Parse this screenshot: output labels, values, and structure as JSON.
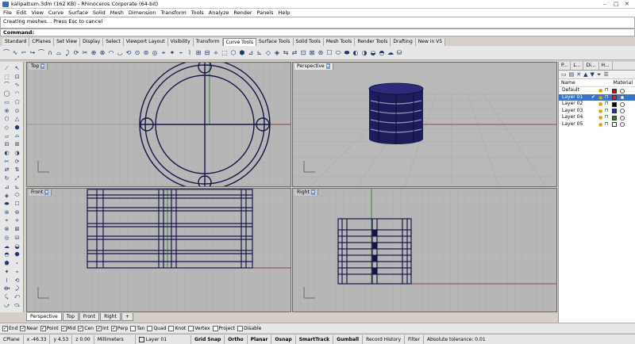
{
  "window": {
    "title": "kalipattum.3dm (162 KB) - Rhinoceros Corporate (64-bit)"
  },
  "menu": [
    "File",
    "Edit",
    "View",
    "Curve",
    "Surface",
    "Solid",
    "Mesh",
    "Dimension",
    "Transform",
    "Tools",
    "Analyze",
    "Render",
    "Panels",
    "Help"
  ],
  "command": {
    "history1": "Creating meshes... Press Esc to cancel",
    "history2": "",
    "prompt": "Command:"
  },
  "tabs": [
    "Standard",
    "CPlanes",
    "Set View",
    "Display",
    "Select",
    "Viewport Layout",
    "Visibility",
    "Transform",
    "Curve Tools",
    "Surface Tools",
    "Solid Tools",
    "Mesh Tools",
    "Render Tools",
    "Drafting",
    "New in V5"
  ],
  "active_tab": "Curve Tools",
  "viewports": {
    "top": "Top",
    "perspective": "Perspective",
    "front": "Front",
    "right": "Right",
    "menu_arrow": "▾"
  },
  "viewport_tabs": [
    "Perspective",
    "Top",
    "Front",
    "Right",
    "+"
  ],
  "osnaps": [
    {
      "label": "End",
      "checked": true
    },
    {
      "label": "Near",
      "checked": true
    },
    {
      "label": "Point",
      "checked": true
    },
    {
      "label": "Mid",
      "checked": true
    },
    {
      "label": "Cen",
      "checked": true
    },
    {
      "label": "Int",
      "checked": true
    },
    {
      "label": "Perp",
      "checked": true
    },
    {
      "label": "Tan",
      "checked": false
    },
    {
      "label": "Quad",
      "checked": false
    },
    {
      "label": "Knot",
      "checked": false
    },
    {
      "label": "Vertex",
      "checked": false
    },
    {
      "label": "Project",
      "checked": false
    },
    {
      "label": "Disable",
      "checked": false
    }
  ],
  "status": {
    "cplane": "CPlane",
    "x": "x -46.33",
    "y": "y 4.53",
    "z": "z 0.00",
    "units": "Millimeters",
    "layer": "Layer 01",
    "layer_color": "#b3151c",
    "grid_snap": "Grid Snap",
    "ortho": "Ortho",
    "planar": "Planar",
    "osnap": "Osnap",
    "smarttrack": "SmartTrack",
    "gumball": "Gumball",
    "record_history": "Record History",
    "filter": "Filter",
    "tolerance": "Absolute tolerance: 0.01"
  },
  "panel": {
    "tabs": [
      "P...",
      "L...",
      "Di...",
      "H..."
    ],
    "col_name": "Name",
    "col_material": "Material",
    "layers": [
      {
        "name": "Default",
        "color": "#000000",
        "selected": false,
        "current": false
      },
      {
        "name": "Layer 01",
        "color": "#e0201c",
        "selected": true,
        "current": true
      },
      {
        "name": "Layer 02",
        "color": "#000000",
        "selected": false,
        "current": false
      },
      {
        "name": "Layer 03",
        "color": "#1a2ccf",
        "selected": false,
        "current": false
      },
      {
        "name": "Layer 04",
        "color": "#1c8a1c",
        "selected": false,
        "current": false
      },
      {
        "name": "Layer 05",
        "color": "#ffffff",
        "selected": false,
        "current": false
      }
    ]
  },
  "icons": {
    "toolbar_count": 46,
    "left_count": 58
  }
}
